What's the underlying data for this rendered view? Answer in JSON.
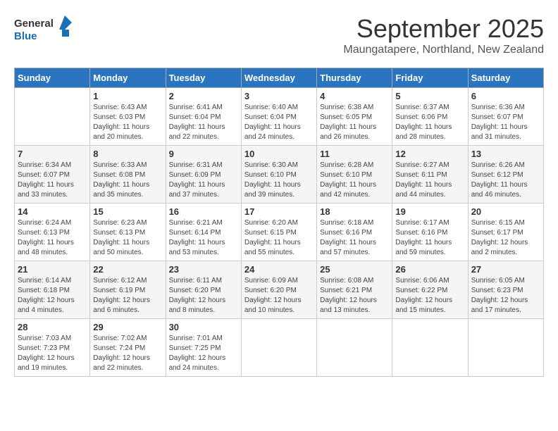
{
  "header": {
    "logo_line1": "General",
    "logo_line2": "Blue",
    "month": "September 2025",
    "location": "Maungatapere, Northland, New Zealand"
  },
  "weekdays": [
    "Sunday",
    "Monday",
    "Tuesday",
    "Wednesday",
    "Thursday",
    "Friday",
    "Saturday"
  ],
  "weeks": [
    [
      {
        "day": "",
        "sunrise": "",
        "sunset": "",
        "daylight": ""
      },
      {
        "day": "1",
        "sunrise": "6:43 AM",
        "sunset": "6:03 PM",
        "daylight": "11 hours and 20 minutes."
      },
      {
        "day": "2",
        "sunrise": "6:41 AM",
        "sunset": "6:04 PM",
        "daylight": "11 hours and 22 minutes."
      },
      {
        "day": "3",
        "sunrise": "6:40 AM",
        "sunset": "6:04 PM",
        "daylight": "11 hours and 24 minutes."
      },
      {
        "day": "4",
        "sunrise": "6:38 AM",
        "sunset": "6:05 PM",
        "daylight": "11 hours and 26 minutes."
      },
      {
        "day": "5",
        "sunrise": "6:37 AM",
        "sunset": "6:06 PM",
        "daylight": "11 hours and 28 minutes."
      },
      {
        "day": "6",
        "sunrise": "6:36 AM",
        "sunset": "6:07 PM",
        "daylight": "11 hours and 31 minutes."
      }
    ],
    [
      {
        "day": "7",
        "sunrise": "6:34 AM",
        "sunset": "6:07 PM",
        "daylight": "11 hours and 33 minutes."
      },
      {
        "day": "8",
        "sunrise": "6:33 AM",
        "sunset": "6:08 PM",
        "daylight": "11 hours and 35 minutes."
      },
      {
        "day": "9",
        "sunrise": "6:31 AM",
        "sunset": "6:09 PM",
        "daylight": "11 hours and 37 minutes."
      },
      {
        "day": "10",
        "sunrise": "6:30 AM",
        "sunset": "6:10 PM",
        "daylight": "11 hours and 39 minutes."
      },
      {
        "day": "11",
        "sunrise": "6:28 AM",
        "sunset": "6:10 PM",
        "daylight": "11 hours and 42 minutes."
      },
      {
        "day": "12",
        "sunrise": "6:27 AM",
        "sunset": "6:11 PM",
        "daylight": "11 hours and 44 minutes."
      },
      {
        "day": "13",
        "sunrise": "6:26 AM",
        "sunset": "6:12 PM",
        "daylight": "11 hours and 46 minutes."
      }
    ],
    [
      {
        "day": "14",
        "sunrise": "6:24 AM",
        "sunset": "6:13 PM",
        "daylight": "11 hours and 48 minutes."
      },
      {
        "day": "15",
        "sunrise": "6:23 AM",
        "sunset": "6:13 PM",
        "daylight": "11 hours and 50 minutes."
      },
      {
        "day": "16",
        "sunrise": "6:21 AM",
        "sunset": "6:14 PM",
        "daylight": "11 hours and 53 minutes."
      },
      {
        "day": "17",
        "sunrise": "6:20 AM",
        "sunset": "6:15 PM",
        "daylight": "11 hours and 55 minutes."
      },
      {
        "day": "18",
        "sunrise": "6:18 AM",
        "sunset": "6:16 PM",
        "daylight": "11 hours and 57 minutes."
      },
      {
        "day": "19",
        "sunrise": "6:17 AM",
        "sunset": "6:16 PM",
        "daylight": "11 hours and 59 minutes."
      },
      {
        "day": "20",
        "sunrise": "6:15 AM",
        "sunset": "6:17 PM",
        "daylight": "12 hours and 2 minutes."
      }
    ],
    [
      {
        "day": "21",
        "sunrise": "6:14 AM",
        "sunset": "6:18 PM",
        "daylight": "12 hours and 4 minutes."
      },
      {
        "day": "22",
        "sunrise": "6:12 AM",
        "sunset": "6:19 PM",
        "daylight": "12 hours and 6 minutes."
      },
      {
        "day": "23",
        "sunrise": "6:11 AM",
        "sunset": "6:20 PM",
        "daylight": "12 hours and 8 minutes."
      },
      {
        "day": "24",
        "sunrise": "6:09 AM",
        "sunset": "6:20 PM",
        "daylight": "12 hours and 10 minutes."
      },
      {
        "day": "25",
        "sunrise": "6:08 AM",
        "sunset": "6:21 PM",
        "daylight": "12 hours and 13 minutes."
      },
      {
        "day": "26",
        "sunrise": "6:06 AM",
        "sunset": "6:22 PM",
        "daylight": "12 hours and 15 minutes."
      },
      {
        "day": "27",
        "sunrise": "6:05 AM",
        "sunset": "6:23 PM",
        "daylight": "12 hours and 17 minutes."
      }
    ],
    [
      {
        "day": "28",
        "sunrise": "7:03 AM",
        "sunset": "7:23 PM",
        "daylight": "12 hours and 19 minutes."
      },
      {
        "day": "29",
        "sunrise": "7:02 AM",
        "sunset": "7:24 PM",
        "daylight": "12 hours and 22 minutes."
      },
      {
        "day": "30",
        "sunrise": "7:01 AM",
        "sunset": "7:25 PM",
        "daylight": "12 hours and 24 minutes."
      },
      {
        "day": "",
        "sunrise": "",
        "sunset": "",
        "daylight": ""
      },
      {
        "day": "",
        "sunrise": "",
        "sunset": "",
        "daylight": ""
      },
      {
        "day": "",
        "sunrise": "",
        "sunset": "",
        "daylight": ""
      },
      {
        "day": "",
        "sunrise": "",
        "sunset": "",
        "daylight": ""
      }
    ]
  ]
}
